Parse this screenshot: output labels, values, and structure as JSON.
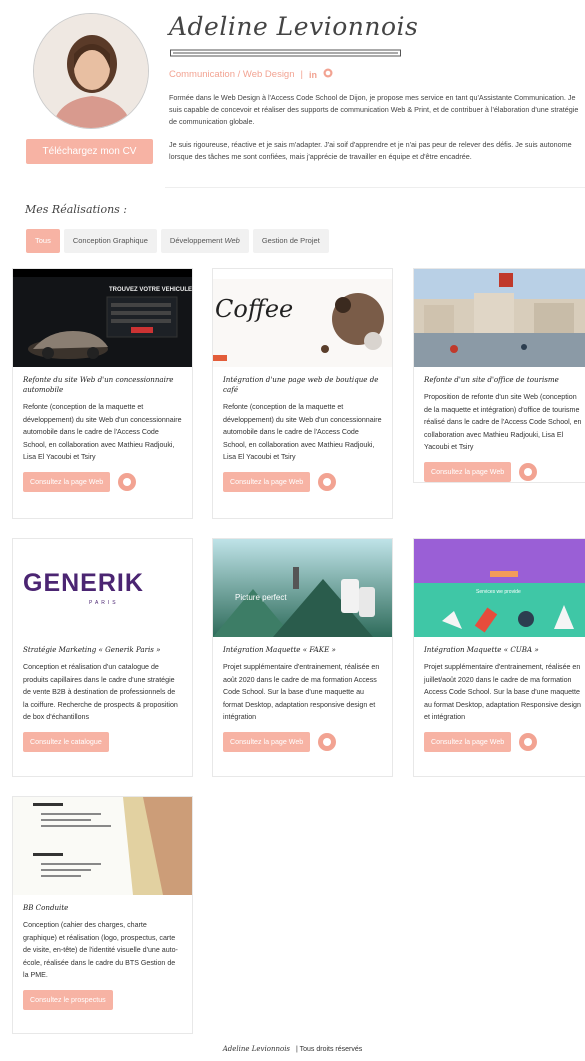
{
  "profile": {
    "name": "Adeline Levionnois",
    "subtitle": "Communication / Web Design",
    "subtitle_sep": "|",
    "linkedin_label": "in",
    "bio_1": "Formée dans le Web Design à l'Access Code School de Dijon, je propose mes service en tant qu'Assistante Communication. Je suis capable de concevoir et réaliser des supports de communication Web & Print, et de contribuer à l'élaboration d'une stratégie de communication globale.",
    "bio_2": "Je suis rigoureuse, réactive et je sais m'adapter. J'ai soif d'apprendre et je n'ai pas peur de relever des défis. Je suis autonome lorsque des tâches me sont confiées, mais j'apprécie de travailler en équipe et d'être encadrée.",
    "cv_button": "Téléchargez mon CV"
  },
  "section": {
    "title": "Mes Réalisations :"
  },
  "filters": [
    {
      "label": "Tous",
      "active": true
    },
    {
      "label": "Conception Graphique",
      "active": false
    },
    {
      "label": "Développement ",
      "label_em": "Web",
      "active": false
    },
    {
      "label": "Gestion de Projet",
      "active": false
    }
  ],
  "cards": [
    {
      "title": "Refonte du site Web d'un concessionnaire automobile",
      "desc": "Refonte (conception de la maquette et développement) du site Web d'un concessionnaire automobile dans le cadre de l'Access Code School, en collaboration avec Mathieu Radjouki, Lisa El Yacoubi et Tsiry",
      "button": "Consultez la page Web",
      "thumb_text": "TROUVEZ VOTRE VEHICULE"
    },
    {
      "title": "Intégration d'une page web de boutique de café",
      "desc": "Refonte (conception de la maquette et développement) du site Web d'un concessionnaire automobile dans le cadre de l'Access Code School, en collaboration avec Mathieu Radjouki, Lisa El Yacoubi et Tsiry",
      "button": "Consultez la page Web",
      "thumb_text": "Coffee"
    },
    {
      "title": "Refonte d'un site d'office de tourisme",
      "desc": "Proposition de refonte d'un site Web (conception de la maquette et intégration) d'office de tourisme réalisé dans le cadre de l'Access Code School, en collaboration avec Mathieu Radjouki, Lisa El Yacoubi et Tsiry",
      "button": "Consultez la page Web"
    },
    {
      "title": "Stratégie Marketing « Generik Paris »",
      "desc": "Conception et réalisation d'un catalogue de produits capillaires dans le cadre d'une stratégie de vente B2B à destination de professionnels de la coiffure. Recherche de prospects & proposition de box d'échantillons",
      "button": "Consultez le catalogue",
      "thumb_text": "GENERIK",
      "thumb_sub": "PARIS"
    },
    {
      "title": "Intégration Maquette « FAKE »",
      "desc": "Projet supplémentaire d'entrainement, réalisée en août 2020 dans le cadre de ma formation Access Code School. Sur la base d'une maquette au format Desktop, adaptation responsive design et intégration",
      "button": "Consultez la page Web",
      "thumb_text": "Picture perfect"
    },
    {
      "title": "Intégration Maquette « CUBA »",
      "desc": "Projet supplémentaire d'entrainement, réalisée en juillet/août 2020 dans le cadre de ma formation Access Code School. Sur la base d'une maquette au format Desktop, adaptation Responsive design et intégration",
      "button": "Consultez la page Web",
      "thumb_text": "Services we provide"
    },
    {
      "title": "BB Conduite",
      "desc": "Conception (cahier des charges, charte graphique) et réalisation (logo, prospectus, carte de visite, en-tête) de l'identité visuelle d'une auto-école, réalisée dans le cadre du BTS Gestion de la PME.",
      "button": "Consultez le prospectus"
    }
  ],
  "footer": {
    "signature": "Adeline Levionnois",
    "text": "|  Tous droits réservés"
  },
  "colors": {
    "accent": "#f7b3a4",
    "accent_text": "#f2a392"
  }
}
